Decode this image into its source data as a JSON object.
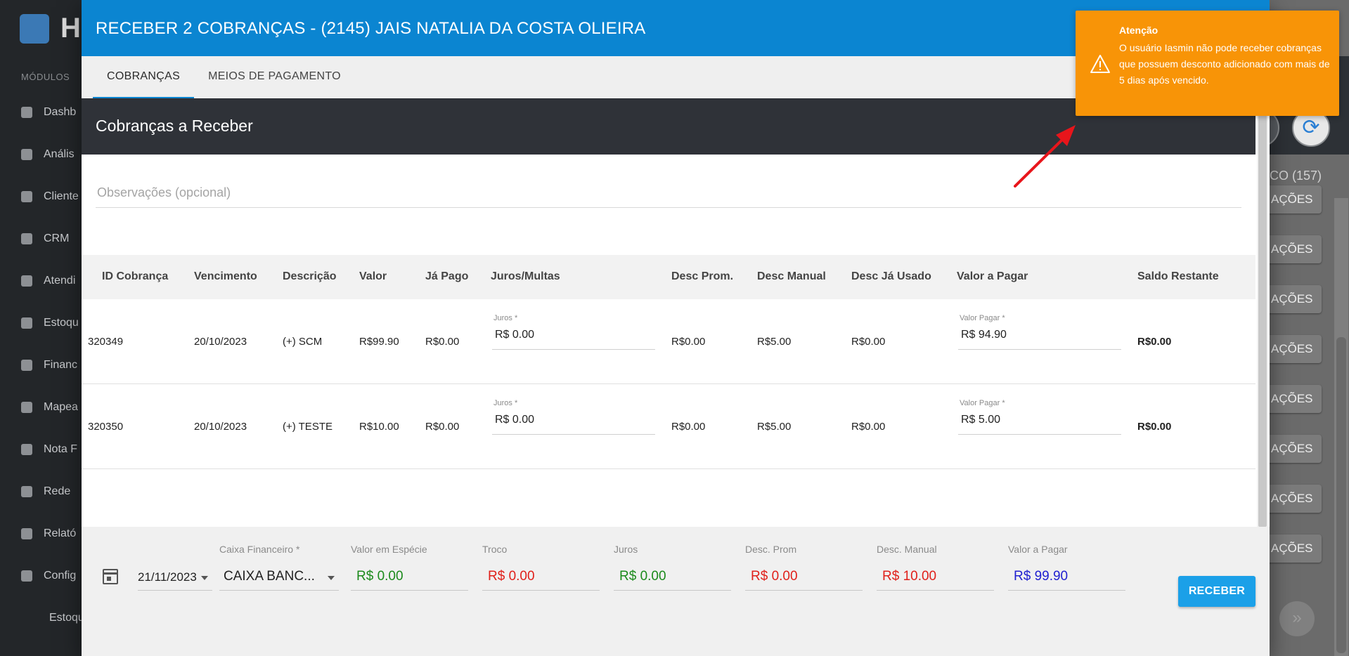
{
  "background": {
    "sidebar": {
      "logo_letter": "H",
      "section_label": "MÓDULOS",
      "items": [
        "Dashb",
        "Anális",
        "Cliente",
        "CRM",
        "Atendi",
        "Estoqu",
        "Financ",
        "Mapea",
        "Nota F",
        "Rede",
        "Relató",
        "Config",
        "Estoqu"
      ]
    },
    "right": {
      "count_label": "CO (157)",
      "button_label": "AÇÕES",
      "refresh_glyph": "⟳",
      "next_glyph": "»"
    }
  },
  "modal": {
    "title": "RECEBER 2 COBRANÇAS - (2145) JAIS NATALIA DA COSTA OLIEIRA",
    "tabs": [
      {
        "label": "COBRANÇAS",
        "active": true
      },
      {
        "label": "MEIOS DE PAGAMENTO",
        "active": false
      }
    ],
    "section_title": "Cobranças a Receber",
    "observacoes_placeholder": "Observações (opcional)",
    "table": {
      "headers": [
        "ID Cobrança",
        "Vencimento",
        "Descrição",
        "Valor",
        "Já Pago",
        "Juros/Multas",
        "Desc Prom.",
        "Desc Manual",
        "Desc Já Usado",
        "Valor a Pagar",
        "Saldo Restante"
      ],
      "juros_label": "Juros *",
      "valor_pagar_label": "Valor Pagar *",
      "rows": [
        {
          "id": "320349",
          "vencimento": "20/10/2023",
          "descricao": "(+) SCM",
          "valor": "R$99.90",
          "ja_pago": "R$0.00",
          "juros": "R$ 0.00",
          "desc_prom": "R$0.00",
          "desc_manual": "R$5.00",
          "desc_ja_usado": "R$0.00",
          "valor_pagar": "R$ 94.90",
          "saldo": "R$0.00"
        },
        {
          "id": "320350",
          "vencimento": "20/10/2023",
          "descricao": "(+) TESTE",
          "valor": "R$10.00",
          "ja_pago": "R$0.00",
          "juros": "R$ 0.00",
          "desc_prom": "R$0.00",
          "desc_manual": "R$5.00",
          "desc_ja_usado": "R$0.00",
          "valor_pagar": "R$ 5.00",
          "saldo": "R$0.00"
        }
      ]
    },
    "footer": {
      "date": "21/11/2023",
      "caixa_label": "Caixa Financeiro *",
      "caixa_value": "CAIXA BANC...",
      "especie_label": "Valor em Espécie",
      "especie_value": "R$ 0.00",
      "troco_label": "Troco",
      "troco_value": "R$ 0.00",
      "juros_label": "Juros",
      "juros_value": "R$ 0.00",
      "desc_prom_label": "Desc. Prom",
      "desc_prom_value": "R$ 0.00",
      "desc_manual_label": "Desc. Manual",
      "desc_manual_value": "R$ 10.00",
      "valor_pagar_label": "Valor a Pagar",
      "valor_pagar_value": "R$ 99.90",
      "receber_label": "RECEBER"
    }
  },
  "toast": {
    "title": "Atenção",
    "message": "O usuário Iasmin não pode receber cobranças que possuem desconto adicionado com mais de 5 dias após vencido."
  },
  "colors": {
    "header_blue": "#0b85d1",
    "toast_orange": "#f89407",
    "value_green": "#1b8a1b",
    "value_red": "#e0201a",
    "value_blue": "#2020d0",
    "arrow_red": "#e8151b"
  }
}
